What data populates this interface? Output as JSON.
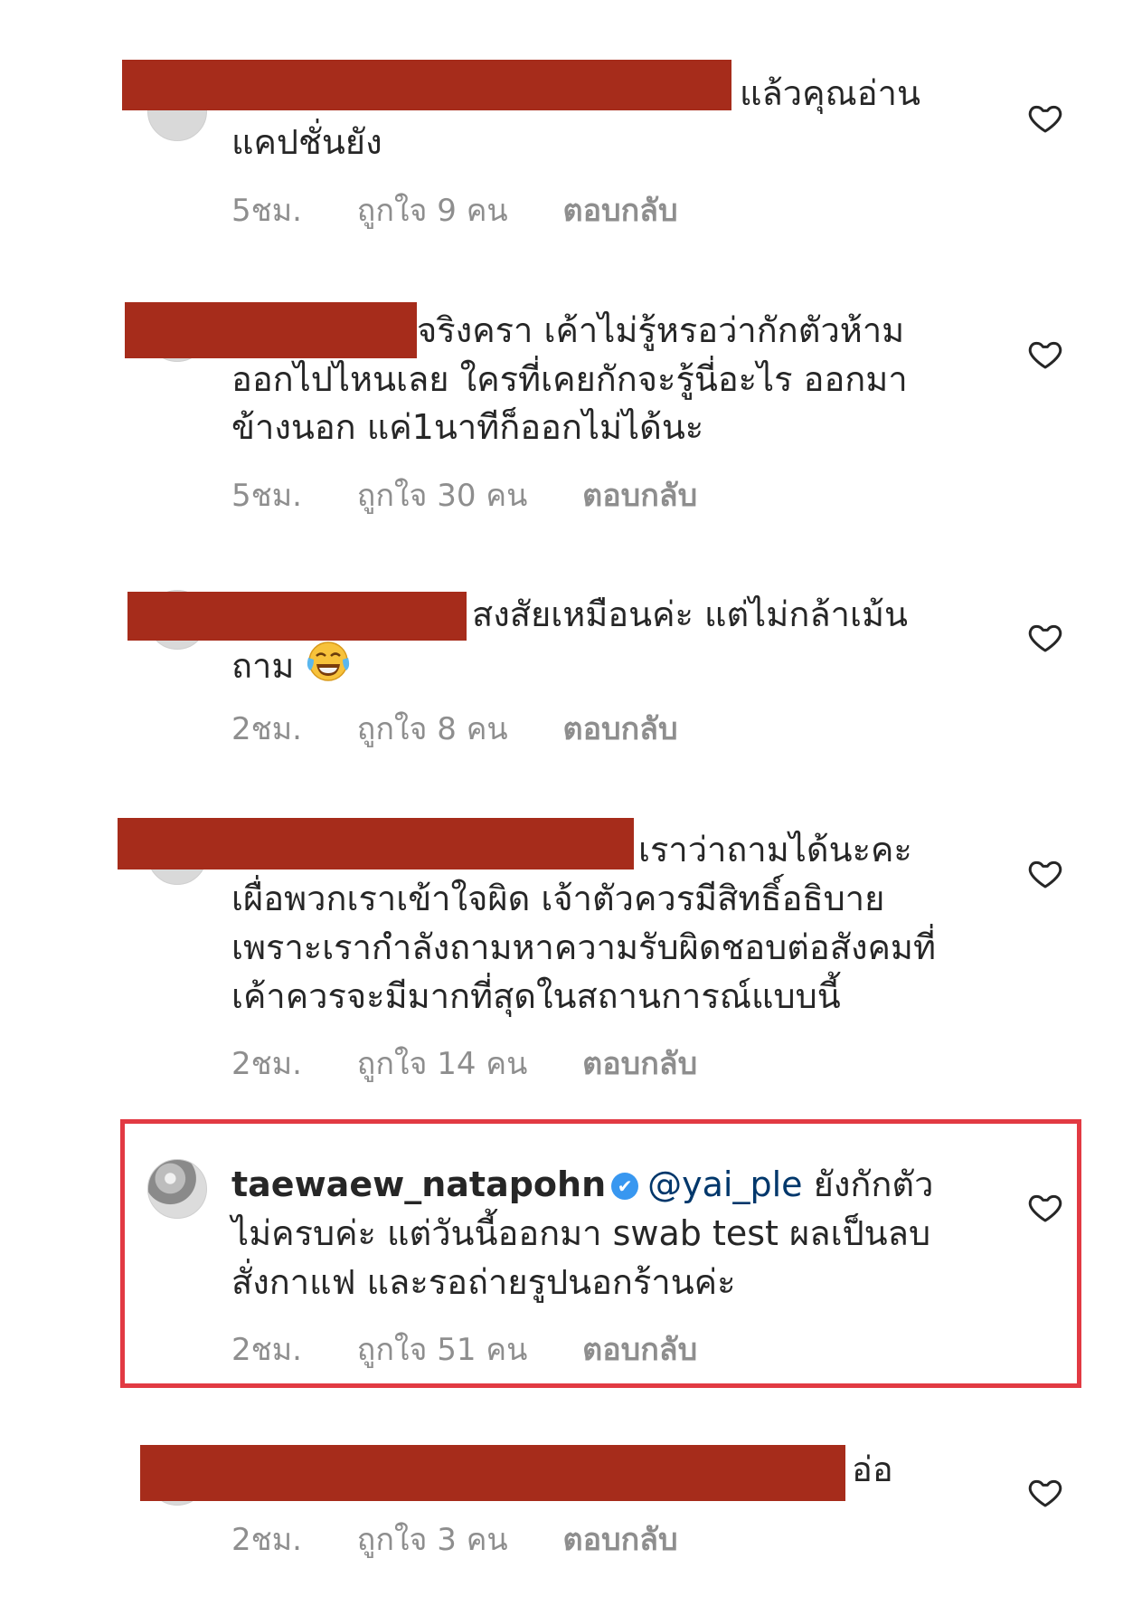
{
  "comments": [
    {
      "text": "แล้วคุณอ่าน                         แคปชั่นยัง",
      "line1": "แล้วคุณอ่าน",
      "line2": "แคปชั่นยัง",
      "time": "5ชม.",
      "likes": "ถูกใจ 9 คน",
      "reply": "ตอบกลับ"
    },
    {
      "line1": "จริงครา เค้าไม่รู้หรอว่ากักตัวห้าม",
      "line2": "ออกไปไหนเลย ใครที่เคยกักจะรู้นี่อะไร ออกมา",
      "line3": "ข้างนอก แค่1นาทีก็ออกไม่ได้นะ",
      "time": "5ชม.",
      "likes": "ถูกใจ 30 คน",
      "reply": "ตอบกลับ"
    },
    {
      "line1": "สงสัยเหมือนค่ะ แต่ไม่กล้าเม้น",
      "line2": "ถาม",
      "emoji": "😂",
      "time": "2ชม.",
      "likes": "ถูกใจ 8 คน",
      "reply": "ตอบกลับ"
    },
    {
      "line1": "เราว่าถามได้นะคะ",
      "line2": "เผื่อพวกเราเข้าใจผิด เจ้าตัวควรมีสิทธิ์อธิบาย",
      "line3": "เพราะเรากำลังถามหาความรับผิดชอบต่อสังคมที่",
      "line4": "เค้าควรจะมีมากที่สุดในสถานการณ์แบบนี้",
      "time": "2ชม.",
      "likes": "ถูกใจ 14 คน",
      "reply": "ตอบกลับ"
    },
    {
      "username": "taewaew_natapohn",
      "verified": "✔",
      "mention": "@yai_ple",
      "line1_rest": " ยังกักตัว",
      "line2": "ไม่ครบค่ะ แต่วันนี้ออกมา swab test ผลเป็นลบ",
      "line3": "สั่งกาแฟ และรอถ่ายรูปนอกร้านค่ะ",
      "time": "2ชม.",
      "likes": "ถูกใจ 51 คน",
      "reply": "ตอบกลับ"
    },
    {
      "line1": "อ่อ",
      "time": "2ชม.",
      "likes": "ถูกใจ 3 คน",
      "reply": "ตอบกลับ"
    }
  ],
  "colors": {
    "redaction": "#a62c1b",
    "highlight_border": "#e23a43",
    "meta_text": "#8e8e8e",
    "verified_badge": "#3897f0",
    "mention": "#00376b"
  },
  "icons": {
    "like": "heart-outline-icon",
    "verified": "verified-badge-icon"
  }
}
